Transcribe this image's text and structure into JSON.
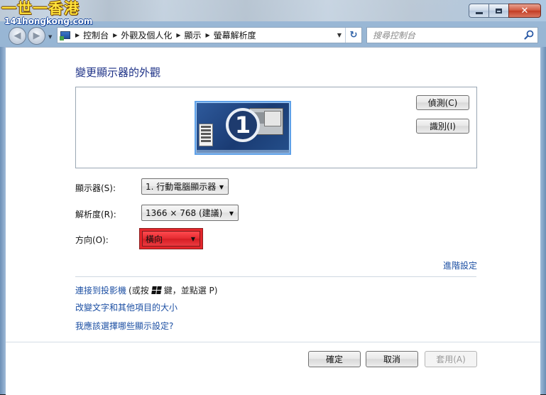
{
  "watermark": {
    "title": "一世一香港",
    "subtitle": "141hongkong.com"
  },
  "window": {
    "minimize_icon": "minimize-icon",
    "maximize_icon": "maximize-icon",
    "close_icon": "close-icon"
  },
  "nav": {
    "back_icon": "back-arrow-icon",
    "forward_icon": "forward-arrow-icon",
    "breadcrumbs": [
      "控制台",
      "外觀及個人化",
      "顯示",
      "螢幕解析度"
    ],
    "search_placeholder": "搜尋控制台"
  },
  "page": {
    "title": "變更顯示器的外觀",
    "monitor_number": "1",
    "detect_label": "偵測(C)",
    "identify_label": "識別(I)"
  },
  "settings": {
    "display_label": "顯示器(S):",
    "display_value": "1. 行動電腦顯示器",
    "resolution_label": "解析度(R):",
    "resolution_value": "1366 × 768 (建議)",
    "orientation_label": "方向(O):",
    "orientation_value": "橫向"
  },
  "links": {
    "advanced": "進階設定",
    "projector_link": "連接到投影機",
    "projector_note_pre": "(或按",
    "projector_note_post": "鍵，並點選 P)",
    "text_size": "改變文字和其他項目的大小",
    "which_settings": "我應該選擇哪些顯示設定?"
  },
  "footer": {
    "ok_label": "確定",
    "cancel_label": "取消",
    "apply_label": "套用(A)"
  },
  "colors": {
    "title_blue": "#1e3287",
    "link_blue": "#1c4fa3",
    "highlight_red": "#e5252b"
  }
}
